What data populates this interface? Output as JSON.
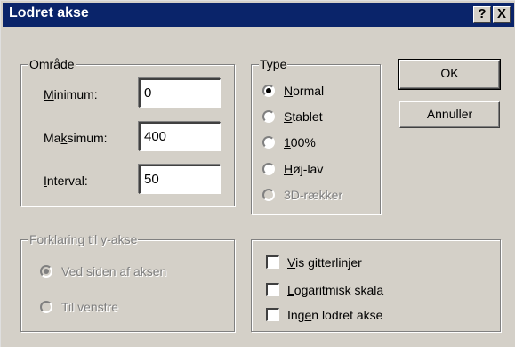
{
  "window": {
    "title": "Lodret akse",
    "help_label": "?",
    "close_label": "X"
  },
  "range_group": {
    "legend": "Område",
    "minimum": {
      "label_pre": "",
      "label_u": "M",
      "label_post": "inimum:",
      "value": "0"
    },
    "maximum": {
      "label_pre": "Ma",
      "label_u": "k",
      "label_post": "simum:",
      "value": "400"
    },
    "interval": {
      "label_pre": "",
      "label_u": "I",
      "label_post": "nterval:",
      "value": "50"
    }
  },
  "type_group": {
    "legend": "Type",
    "options": [
      {
        "pre": "",
        "u": "N",
        "post": "ormal",
        "selected": true,
        "enabled": true
      },
      {
        "pre": "",
        "u": "S",
        "post": "tablet",
        "selected": false,
        "enabled": true
      },
      {
        "pre": "",
        "u": "1",
        "post": "00%",
        "selected": false,
        "enabled": true
      },
      {
        "pre": "",
        "u": "H",
        "post": "øj-lav",
        "selected": false,
        "enabled": true
      },
      {
        "pre": "",
        "u": "",
        "post": "3D-rækker",
        "selected": false,
        "enabled": false
      }
    ]
  },
  "buttons": {
    "ok": "OK",
    "cancel": "Annuller"
  },
  "legend_group": {
    "legend": "Forklaring til y-akse",
    "options": [
      {
        "label": "Ved siden af aksen",
        "selected": true,
        "enabled": false
      },
      {
        "label": "Til venstre",
        "selected": false,
        "enabled": false
      }
    ]
  },
  "options_group": {
    "checkboxes": [
      {
        "pre": "",
        "u": "V",
        "post": "is gitterlinjer",
        "checked": false
      },
      {
        "pre": "",
        "u": "L",
        "post": "ogaritmisk skala",
        "checked": false
      },
      {
        "pre": "Ing",
        "u": "e",
        "post": "n lodret akse",
        "checked": false
      }
    ]
  }
}
